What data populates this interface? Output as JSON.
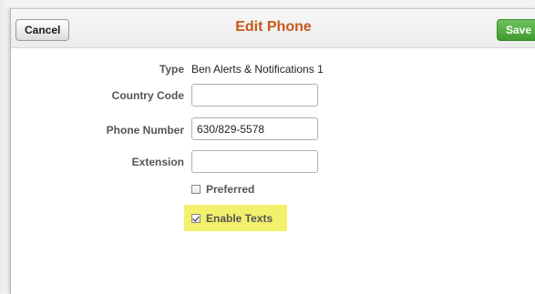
{
  "dialog": {
    "title": "Edit Phone",
    "cancel_label": "Cancel",
    "save_label": "Save"
  },
  "form": {
    "type_label": "Type",
    "type_value": "Ben Alerts & Notifications 1",
    "country_code_label": "Country Code",
    "country_code_value": "",
    "phone_number_label": "Phone Number",
    "phone_number_value": "630/829-5578",
    "extension_label": "Extension",
    "extension_value": "",
    "preferred_label": "Preferred",
    "preferred_checked": false,
    "enable_texts_label": "Enable Texts",
    "enable_texts_checked": true
  },
  "colors": {
    "title": "#c8581b",
    "save_button": "#4caf3a",
    "highlight": "#f3f16c"
  }
}
